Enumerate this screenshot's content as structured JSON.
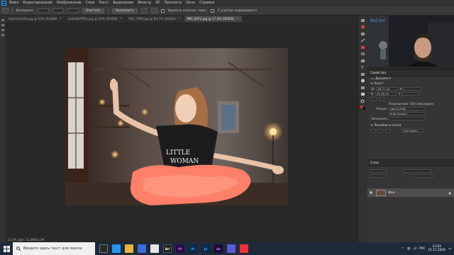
{
  "app": {
    "logo": "Ps",
    "menu": [
      "Файл",
      "Редактирование",
      "Изображение",
      "Слои",
      "Текст",
      "Выделение",
      "Фильтр",
      "3D",
      "Просмотр",
      "Окно",
      "Справка"
    ]
  },
  "options_bar": {
    "interpolation_label": "Интерпол.",
    "button_clear": "Очистить",
    "button_straighten": "Выпрямить",
    "delete_cropped_label": "Удалить отрезан. пикс.",
    "content_aware_label": "С учетом содержимого"
  },
  "document_tabs": [
    {
      "label": "kids7bed13k.jpg @ 50% (RGB/8)",
      "active": false
    },
    {
      "label": "belka8VPPDk.jpg @ 50% (RGB/8)",
      "active": false
    },
    {
      "label": "IMG_7996.jpg @ 84,7% (RGB/8)",
      "active": false
    },
    {
      "label": "IMG_9071.jpg @ 17,4% (RGB/8)",
      "active": true
    }
  ],
  "photo": {
    "shirt_text_line1": "LITTLE",
    "shirt_text_line2": "WOMAN"
  },
  "webcam": {
    "overlay_text": "BeCam"
  },
  "properties_panel": {
    "title": "Свойства",
    "subtitle": "Документ",
    "canvas_section": "Холст",
    "width_label": "Ш",
    "width_value": "46,77 см",
    "height_label": "В",
    "height_value": "31,18 см",
    "x_label": "X",
    "y_label": "Y",
    "resolution_label": "Разрешение: 300 пикс/дюйм",
    "mode_label": "Режим",
    "mode_value": "Цвета RGB",
    "depth_value": "8 бит/канал",
    "fill_label": "Заполнить",
    "rulers_section": "Линейки и сетки",
    "rulers_unit": "Сантимет..."
  },
  "layers_panel": {
    "title": "Слои",
    "layer_name": "Фон"
  },
  "status": {
    "zoom": "17,4%",
    "doc_info": "Док: 51,0M/51,0M"
  },
  "taskbar": {
    "search_placeholder": "Введите здесь текст для поиска",
    "tray_lang": "РУС",
    "time": "13:03",
    "date": "12.11.2020",
    "app_badges": [
      "Bri",
      "Pr",
      "Ps",
      "Lr",
      "Ae"
    ]
  },
  "colors": {
    "ps_blue": "#31a8ff",
    "panel_bg": "#353535",
    "app_bg": "#282828",
    "tutu": "#ff7f68"
  }
}
